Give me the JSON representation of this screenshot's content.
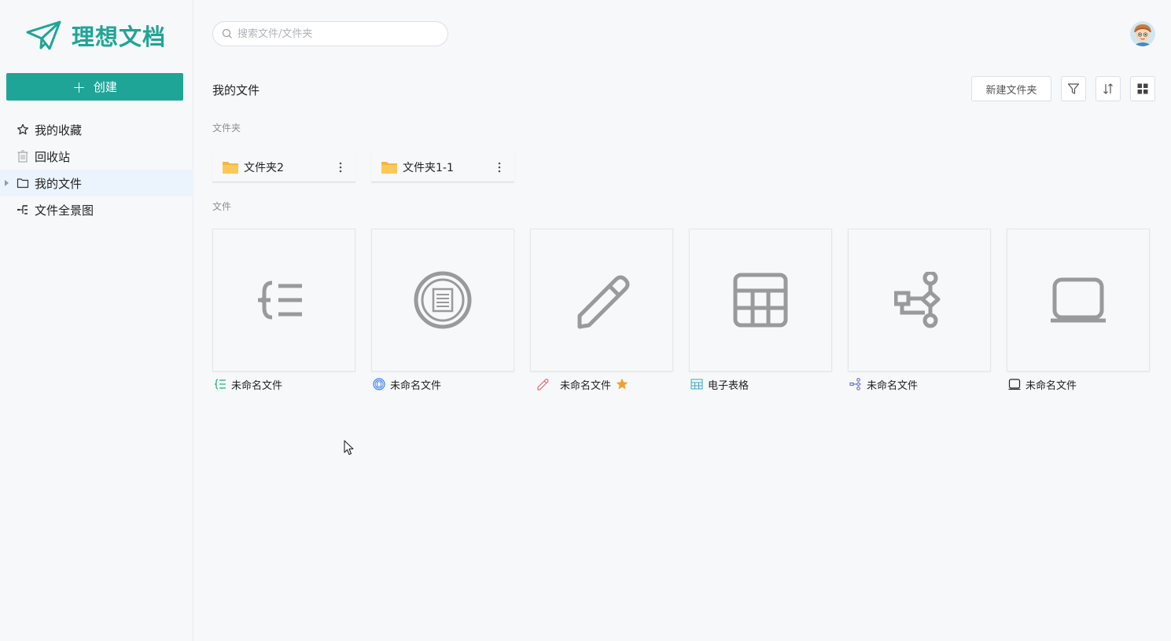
{
  "app": {
    "name": "理想文档",
    "create_label": "创建",
    "brand_color": "#1fa597"
  },
  "sidebar": {
    "items": [
      {
        "label": "我的收藏",
        "icon": "star-outline-icon"
      },
      {
        "label": "回收站",
        "icon": "trash-icon"
      },
      {
        "label": "我的文件",
        "icon": "folder-outline-icon",
        "active": true
      },
      {
        "label": "文件全景图",
        "icon": "tree-map-icon"
      }
    ]
  },
  "search": {
    "placeholder": "搜索文件/文件夹",
    "value": ""
  },
  "main": {
    "title": "我的文件",
    "toolbar": {
      "new_folder_label": "新建文件夹",
      "filter_icon": "filter-icon",
      "sort_icon": "sort-icon",
      "view_icon": "grid-view-icon"
    },
    "folders_section_label": "文件夹",
    "folders": [
      {
        "name": "文件夹2"
      },
      {
        "name": "文件夹1-1"
      }
    ],
    "files_section_label": "文件",
    "files": [
      {
        "name": "未命名文件",
        "type": "mindmap",
        "icon": "mindmap-icon",
        "color": "#2bb673"
      },
      {
        "name": "未命名文件",
        "type": "document",
        "icon": "document-circle-icon",
        "color": "#3b82f6"
      },
      {
        "name": "未命名文件",
        "type": "whiteboard",
        "icon": "pencil-icon",
        "color": "#e26b6b",
        "starred": true
      },
      {
        "name": "电子表格",
        "type": "spreadsheet",
        "icon": "table-icon",
        "color": "#3aa6c2"
      },
      {
        "name": "未命名文件",
        "type": "flowchart",
        "icon": "flowchart-icon",
        "color": "#5b6dd6"
      },
      {
        "name": "未命名文件",
        "type": "slides",
        "icon": "screen-icon",
        "color": "#222222"
      }
    ]
  }
}
